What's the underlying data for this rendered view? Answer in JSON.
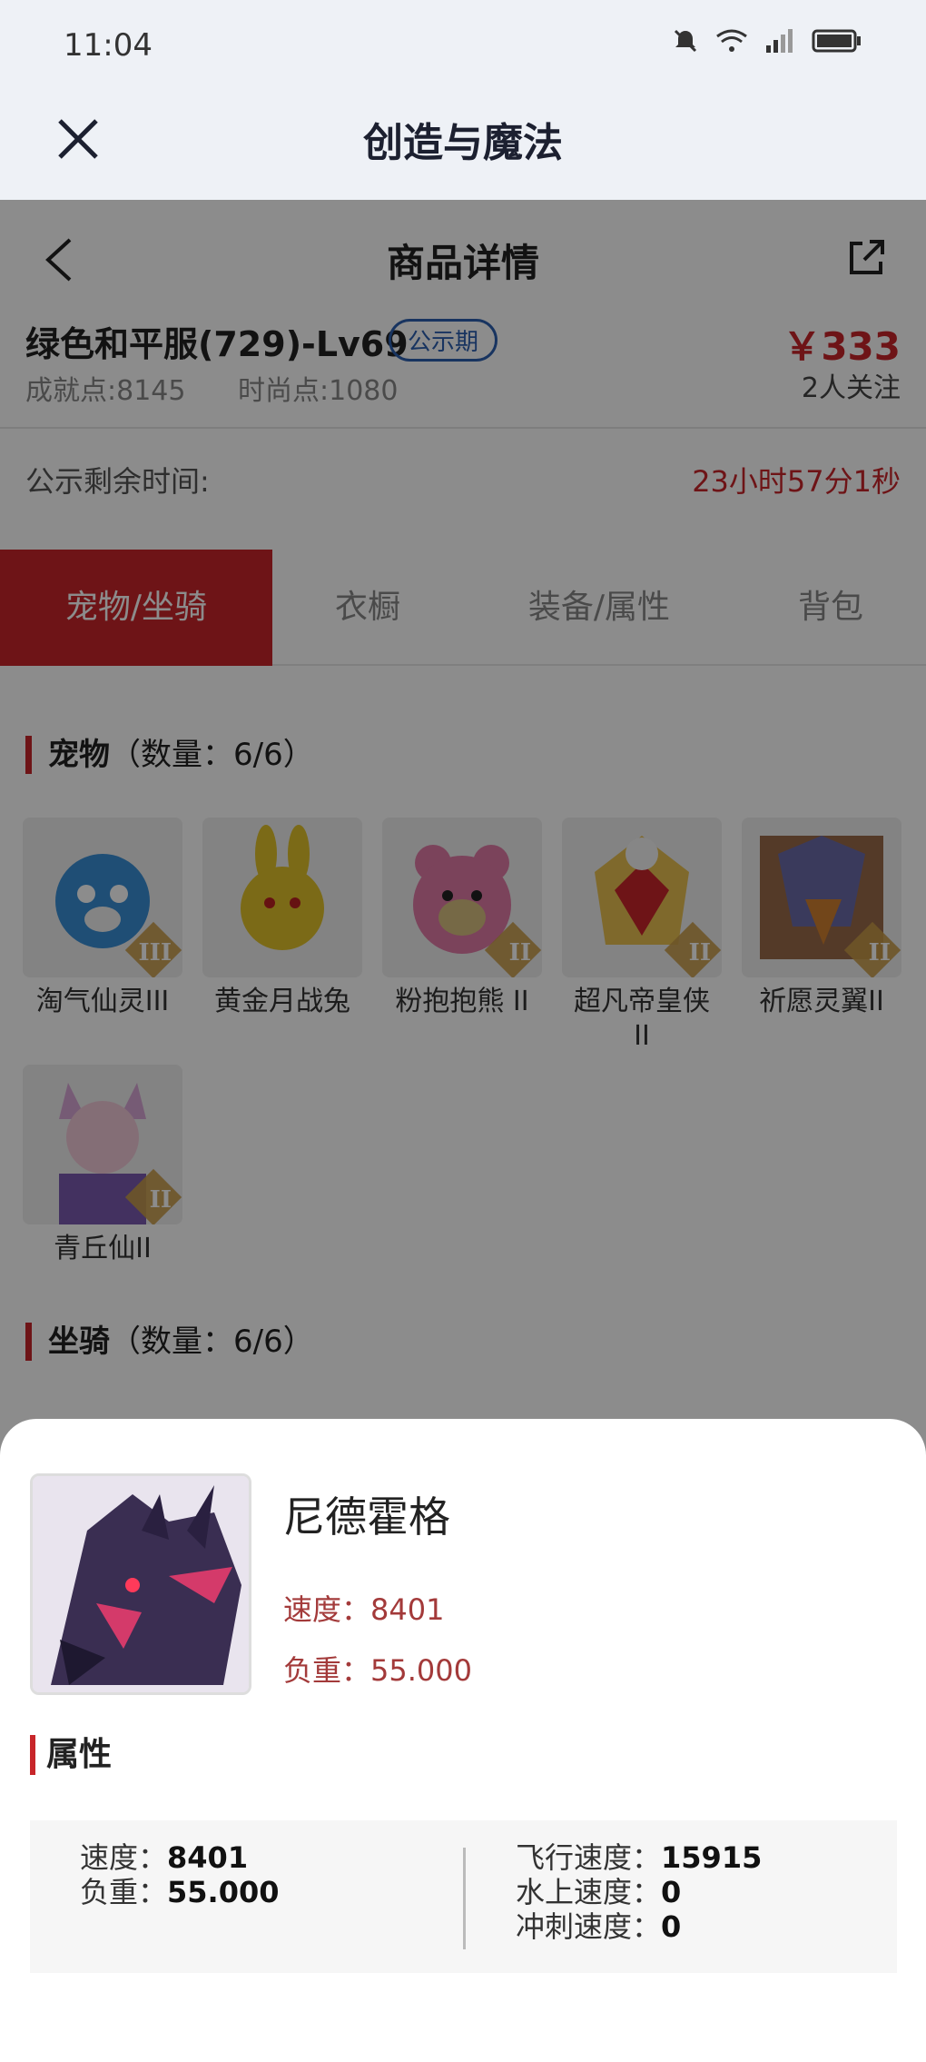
{
  "status": {
    "time": "11:04"
  },
  "app": {
    "title": "创造与魔法"
  },
  "nav": {
    "title": "商品详情"
  },
  "product": {
    "name": "绿色和平服(729)-Lv69",
    "badge": "公示期",
    "price": "￥333",
    "achievement": "成就点:8145",
    "fashion": "时尚点:1080",
    "followers": "2人关注"
  },
  "publicity": {
    "label": "公示剩余时间:",
    "value": "23小时57分1秒"
  },
  "tabs": [
    "宠物/坐骑",
    "衣橱",
    "装备/属性",
    "背包"
  ],
  "pets_section": {
    "title": "宠物",
    "count": "（数量：6/6）"
  },
  "pets": [
    {
      "label": "淘气仙灵III",
      "tier": "III",
      "color": "#3a8fd6"
    },
    {
      "label": "黄金月战兔",
      "tier": "",
      "color": "#e0c12a"
    },
    {
      "label": "粉抱抱熊 II",
      "tier": "II",
      "color": "#e07aa6"
    },
    {
      "label": "超凡帝皇侠 II",
      "tier": "II",
      "color": "#e8c050"
    },
    {
      "label": "祈愿灵翼II",
      "tier": "II",
      "color": "#b0503a"
    },
    {
      "label": "青丘仙II",
      "tier": "II",
      "color": "#d8a6d6"
    }
  ],
  "mounts_section": {
    "title": "坐骑",
    "count": "（数量：6/6）"
  },
  "sheet": {
    "name": "尼德霍格",
    "speed": "速度：8401",
    "load": "负重：55.000",
    "attr_title": "属性",
    "left": [
      {
        "label": "速度：",
        "value": "8401"
      },
      {
        "label": "负重：",
        "value": "55.000"
      }
    ],
    "right": [
      {
        "label": "飞行速度：",
        "value": "15915"
      },
      {
        "label": "水上速度：",
        "value": "0"
      },
      {
        "label": "冲刺速度：",
        "value": "0"
      }
    ]
  }
}
